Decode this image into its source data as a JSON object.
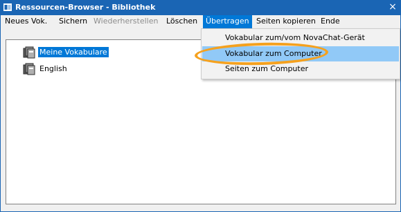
{
  "window": {
    "title": "Ressourcen-Browser - Bibliothek",
    "close_symbol": "×"
  },
  "menubar": {
    "items": [
      {
        "label": "Neues Vok.",
        "state": "normal"
      },
      {
        "label": "Sichern",
        "state": "normal"
      },
      {
        "label": "Wiederherstellen",
        "state": "disabled"
      },
      {
        "label": "Löschen",
        "state": "normal"
      },
      {
        "label": "Übertragen",
        "state": "active"
      },
      {
        "label": "Seiten kopieren",
        "state": "normal"
      },
      {
        "label": "Ende",
        "state": "normal"
      }
    ]
  },
  "tree": {
    "items": [
      {
        "label": "Meine Vokabulare",
        "selected": true,
        "icon": "book-stack-icon"
      },
      {
        "label": "English",
        "selected": false,
        "icon": "book-stack-icon"
      }
    ]
  },
  "dropdown": {
    "items": [
      {
        "label": "Vokabular zum/vom NovaChat-Gerät"
      },
      {
        "label": "Vokabular zum Computer",
        "hovered": true
      },
      {
        "label": "Seiten zum Computer"
      }
    ]
  },
  "colors": {
    "titlebar": "#1a65b4",
    "selection": "#0078d7",
    "menu_hover": "#91c9f7",
    "annotation": "#f5a11e"
  }
}
